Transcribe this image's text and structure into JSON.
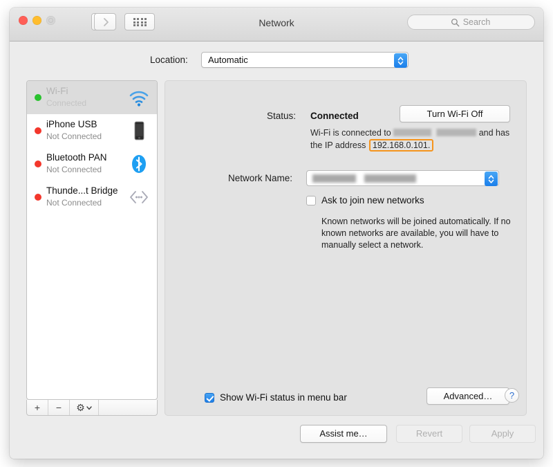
{
  "window": {
    "title": "Network",
    "traffic_lights": [
      "close",
      "minimize",
      "zoom"
    ]
  },
  "toolbar": {
    "back_icon": "chevron-left-icon",
    "forward_icon": "chevron-right-icon",
    "grid_icon": "show-all-grid-icon",
    "search_placeholder": "Search",
    "search_icon": "search-icon"
  },
  "location": {
    "label": "Location:",
    "value": "Automatic"
  },
  "sidebar": {
    "services": [
      {
        "name": "Wi-Fi",
        "state": "Connected",
        "status_color": "#29c22e",
        "icon": "wifi-icon",
        "selected": true
      },
      {
        "name": "iPhone USB",
        "state": "Not Connected",
        "status_color": "#f3372c",
        "icon": "iphone-icon",
        "selected": false
      },
      {
        "name": "Bluetooth PAN",
        "state": "Not Connected",
        "status_color": "#f3372c",
        "icon": "bluetooth-icon",
        "selected": false
      },
      {
        "name": "Thunde...t Bridge",
        "state": "Not Connected",
        "status_color": "#f3372c",
        "icon": "thunderbolt-bridge-icon",
        "selected": false
      }
    ],
    "toolbar": {
      "add_label": "+",
      "remove_label": "−",
      "action_label": "⚙"
    }
  },
  "panel": {
    "status_label": "Status:",
    "status_value": "Connected",
    "turn_wifi_off_label": "Turn Wi-Fi Off",
    "status_desc_prefix": "Wi-Fi is connected to",
    "status_desc_middle": "and has",
    "status_desc_line2": "the IP address",
    "ip_address": "192.168.0.101.",
    "ip_highlight_color": "#f5941d",
    "network_name_label": "Network Name:",
    "network_name_value": "",
    "ask_to_join_label": "Ask to join new networks",
    "ask_to_join_checked": false,
    "known_networks_text": "Known networks will be joined automatically. If no known networks are available, you will have to manually select a network.",
    "show_status_label": "Show Wi-Fi status in menu bar",
    "show_status_checked": true,
    "advanced_label": "Advanced…",
    "help_label": "?"
  },
  "footer": {
    "assist_label": "Assist me…",
    "revert_label": "Revert",
    "apply_label": "Apply"
  }
}
